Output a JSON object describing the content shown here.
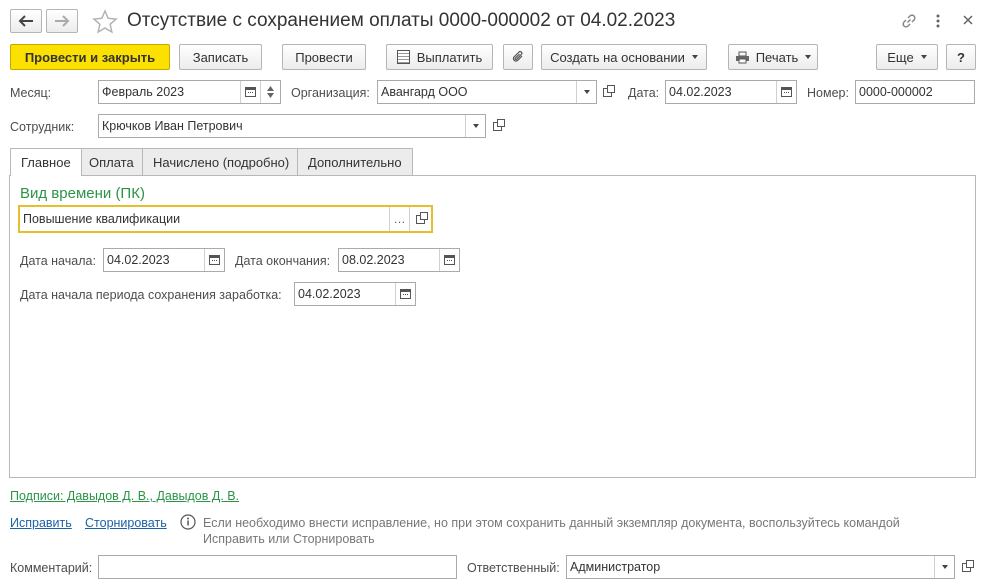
{
  "window": {
    "title": "Отсутствие с сохранением оплаты 0000-000002 от 04.02.2023"
  },
  "toolbar": {
    "post_close": "Провести и закрыть",
    "save": "Записать",
    "post": "Провести",
    "pay": "Выплатить",
    "create_based": "Создать на основании",
    "print": "Печать",
    "more": "Еще",
    "help": "?"
  },
  "header": {
    "month_label": "Месяц:",
    "month_value": "Февраль 2023",
    "org_label": "Организация:",
    "org_value": "Авангард ООО",
    "date_label": "Дата:",
    "date_value": "04.02.2023",
    "number_label": "Номер:",
    "number_value": "0000-000002",
    "employee_label": "Сотрудник:",
    "employee_value": "Крючков Иван Петрович"
  },
  "tabs": [
    {
      "label": "Главное"
    },
    {
      "label": "Оплата"
    },
    {
      "label": "Начислено (подробно)"
    },
    {
      "label": "Дополнительно"
    }
  ],
  "main": {
    "time_kind_title": "Вид времени (ПК)",
    "time_kind_value": "Повышение квалификации",
    "start_label": "Дата начала:",
    "start_value": "04.02.2023",
    "end_label": "Дата окончания:",
    "end_value": "08.02.2023",
    "period_label": "Дата начала периода сохранения заработка:",
    "period_value": "04.02.2023"
  },
  "footer": {
    "signatures": "Подписи: Давыдов Д. В., Давыдов Д. В.",
    "fix": "Исправить",
    "reverse": "Сторнировать",
    "hint_line1": "Если необходимо внести исправление, но при этом сохранить данный экземпляр документа, воспользуйтесь командой",
    "hint_line2": "Исправить или Сторнировать",
    "comment_label": "Комментарий:",
    "comment_value": "",
    "responsible_label": "Ответственный:",
    "responsible_value": "Администратор"
  },
  "colors": {
    "accent_green": "#2b9447",
    "primary_button": "#fbe000",
    "link_blue": "#1a62a8",
    "focus_border": "#e6bf2e"
  }
}
